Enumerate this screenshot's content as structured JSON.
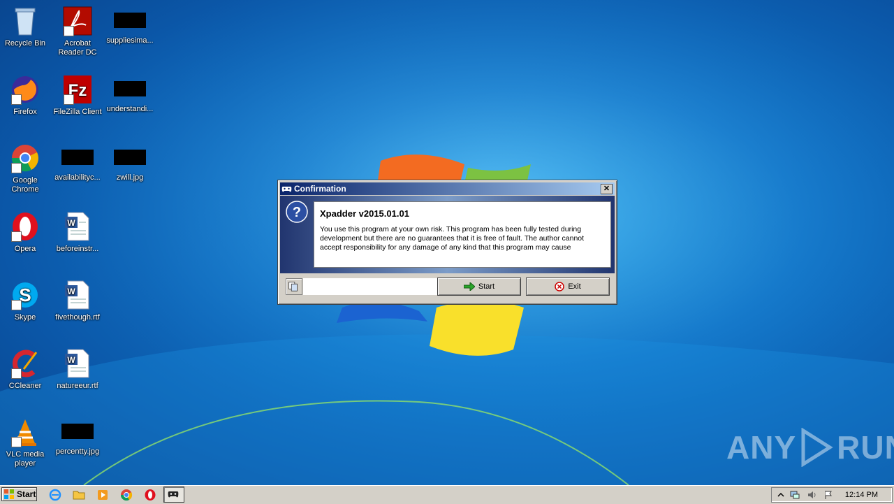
{
  "desktop": {
    "icons": [
      {
        "label": "Recycle Bin"
      },
      {
        "label": "Acrobat Reader DC"
      },
      {
        "label": "suppliesima..."
      },
      {
        "label": "Firefox"
      },
      {
        "label": "FileZilla Client"
      },
      {
        "label": "understandi..."
      },
      {
        "label": "Google Chrome"
      },
      {
        "label": "availabilityc..."
      },
      {
        "label": "zwill.jpg"
      },
      {
        "label": "Opera"
      },
      {
        "label": "beforeinstr..."
      },
      {
        "label": "Skype"
      },
      {
        "label": "fivethough.rtf"
      },
      {
        "label": "CCleaner"
      },
      {
        "label": "natureeur.rtf"
      },
      {
        "label": "VLC media player"
      },
      {
        "label": "percentty.jpg"
      }
    ]
  },
  "dialog": {
    "title": "Confirmation",
    "close_label": "✕",
    "heading": "Xpadder v2015.01.01",
    "message": "You use this program at your own risk. This program has been fully tested during development but there are no guarantees that it is free of fault. The author cannot accept responsibility for any damage of any kind that this program may cause",
    "start_label": "Start",
    "exit_label": "Exit"
  },
  "taskbar": {
    "start_label": "Start",
    "clock": "12:14 PM"
  },
  "watermark": {
    "left": "ANY",
    "right": "RUN"
  },
  "colors": {
    "title_gradient_start": "#0a246a",
    "title_gradient_end": "#a6caf0",
    "desktop_blue": "#1276c9"
  }
}
